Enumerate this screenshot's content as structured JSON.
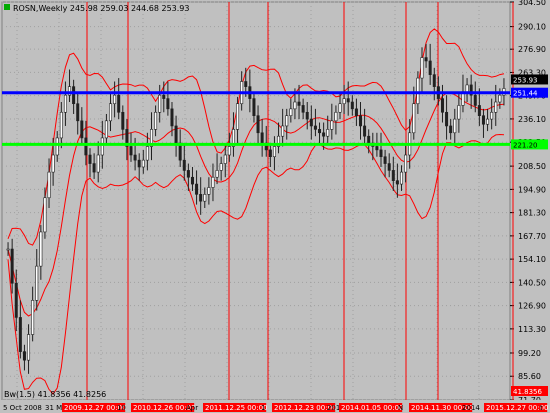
{
  "symbol_title": "ROSN,Weekly",
  "ohlc_text": "245.98 259.03 244.68 253.93",
  "indicator_text": "Bw(1.5) 41.8356 41.8256",
  "colors": {
    "background": "#c0c0c0",
    "grid": "#a0a0a0",
    "candles": "#202020",
    "bollinger": "#ff0000",
    "blue_line": "#0000ff",
    "green_line": "#00ff00",
    "vertical_lines": "#ff0000",
    "date_box": "#ff0000"
  },
  "chart_data": {
    "type": "candlestick",
    "ylim": [
      71.7,
      304.5
    ],
    "y_ticks": [
      "304.50",
      "290.10",
      "276.90",
      "263.30",
      "249.70",
      "236.10",
      "222.50",
      "208.50",
      "194.90",
      "181.30",
      "167.70",
      "154.10",
      "140.50",
      "126.90",
      "113.30",
      "99.20",
      "85.60",
      "71.70"
    ],
    "horizontal_levels": [
      {
        "name": "blue",
        "value": 251.44,
        "label": "251.44"
      },
      {
        "name": "green",
        "value": 221.2,
        "label": "221.20"
      }
    ],
    "current_price": {
      "value": 253.93,
      "label": "253.93"
    },
    "bottom_value_label": "41.8356",
    "x_labels": [
      "5 Oct 2008",
      "31 M",
      "2009.12.27 00:00",
      "10",
      "2010.12.26 00:00",
      "Apr",
      "2011.12.25 00:00",
      "1",
      "2012.12.23 00:00",
      "2013",
      "2014.01.05 00:00",
      "N",
      "2014.11.30 00:00",
      "2014",
      "2015.12.27 00:00",
      "t"
    ],
    "highlighted_dates": [
      "2009.12.27 00:00",
      "2010.12.26 00:00",
      "2011.12.25 00:00",
      "2012.12.23 00:00",
      "2014.01.05 00:00",
      "2014.11.30 00:00",
      "2015.12.27 00:00"
    ],
    "series": [
      {
        "name": "close",
        "values": [
          160,
          140,
          120,
          100,
          95,
          110,
          130,
          150,
          170,
          190,
          205,
          215,
          225,
          240,
          250,
          255,
          245,
          235,
          225,
          215,
          210,
          205,
          215,
          225,
          235,
          245,
          250,
          240,
          230,
          220,
          215,
          212,
          208,
          212,
          220,
          230,
          240,
          250,
          248,
          242,
          232,
          222,
          212,
          206,
          202,
          198,
          192,
          188,
          192,
          196,
          202,
          206,
          210,
          215,
          220,
          230,
          245,
          258,
          255,
          248,
          238,
          228,
          222,
          218,
          214,
          220,
          226,
          232,
          238,
          242,
          246,
          244,
          240,
          236,
          232,
          230,
          228,
          226,
          230,
          235,
          240,
          245,
          248,
          246,
          242,
          238,
          232,
          226,
          222,
          220,
          218,
          214,
          210,
          206,
          200,
          198,
          205,
          215,
          228,
          245,
          260,
          272,
          270,
          262,
          255,
          248,
          240,
          232,
          228,
          236,
          244,
          252,
          256,
          250,
          244,
          238,
          233,
          236,
          240,
          246,
          250,
          253.93
        ]
      }
    ]
  }
}
